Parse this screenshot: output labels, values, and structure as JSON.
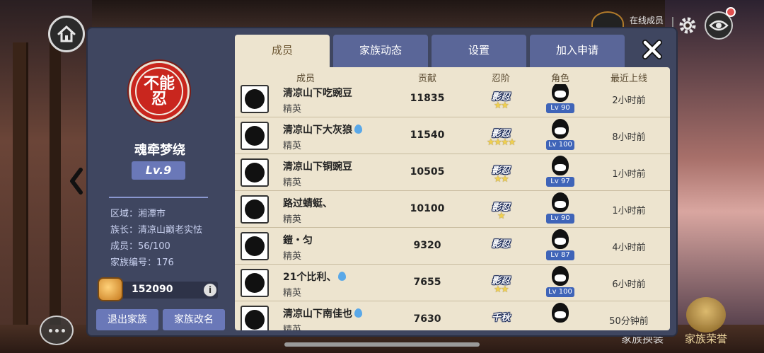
{
  "panel": {
    "clan_name": "魂牵梦绕",
    "clan_level": "Lv.9",
    "emblem_text": "不能忍",
    "region": "区域：湘潭市",
    "leader": "族长：清凉山巅老实怯",
    "members": "成员：56/100",
    "clan_id": "家族编号：176",
    "coins": "152090",
    "info_symbol": "i",
    "btn_leave": "退出家族",
    "btn_rename": "家族改名"
  },
  "tabs": [
    {
      "label": "成员",
      "active": true
    },
    {
      "label": "家族动态",
      "active": false
    },
    {
      "label": "设置",
      "active": false
    },
    {
      "label": "加入申请",
      "active": false
    }
  ],
  "table": {
    "headers": {
      "member": "成员",
      "contribution": "贡献",
      "rank": "忍阶",
      "character": "角色",
      "last_online": "最近上线"
    },
    "rows": [
      {
        "name": "清凉山下吃豌豆",
        "drop": false,
        "role": "精英",
        "contribution": "11835",
        "rank": "影忍",
        "stars": 2,
        "level": "Lv 90",
        "last_online": "2小时前"
      },
      {
        "name": "清凉山下大灰狼",
        "drop": true,
        "role": "精英",
        "contribution": "11540",
        "rank": "影忍",
        "stars": 4,
        "level": "Lv 100",
        "last_online": "8小时前"
      },
      {
        "name": "清凉山下铜豌豆",
        "drop": false,
        "role": "精英",
        "contribution": "10505",
        "rank": "影忍",
        "stars": 2,
        "level": "Lv 97",
        "last_online": "1小时前"
      },
      {
        "name": "路过蜻蜓、",
        "drop": false,
        "role": "精英",
        "contribution": "10100",
        "rank": "影忍",
        "stars": 1,
        "level": "Lv 90",
        "last_online": "1小时前"
      },
      {
        "name": "鎧・匀",
        "drop": false,
        "role": "精英",
        "contribution": "9320",
        "rank": "影忍",
        "stars": 0,
        "level": "Lv 87",
        "last_online": "4小时前"
      },
      {
        "name": "21个比利、",
        "drop": true,
        "role": "精英",
        "contribution": "7655",
        "rank": "影忍",
        "stars": 2,
        "level": "Lv 100",
        "last_online": "6小时前"
      },
      {
        "name": "清凉山下南佳也",
        "drop": true,
        "role": "精英",
        "contribution": "7630",
        "rank": "千秋",
        "stars": 0,
        "level": "",
        "last_online": "50分钟前"
      }
    ]
  },
  "hud": {
    "online_label": "在线成员",
    "online_count": "",
    "bottom_left_label": "家族换装",
    "bottom_right_label": "家族荣誉"
  },
  "colors": {
    "panel_bg": "#3f4660",
    "tab_active": "#ede4cf",
    "tab_inactive": "#5a6698",
    "accent_button": "#6a78b8",
    "emblem_red": "#c9261e",
    "level_badge": "#3f64b8"
  },
  "icons": [
    "home-icon",
    "chevron-left-icon",
    "chat-icon",
    "gear-icon",
    "eye-icon",
    "close-icon",
    "coin-bag-icon",
    "info-icon",
    "water-drop-icon",
    "star-icon",
    "trophy-icon"
  ]
}
